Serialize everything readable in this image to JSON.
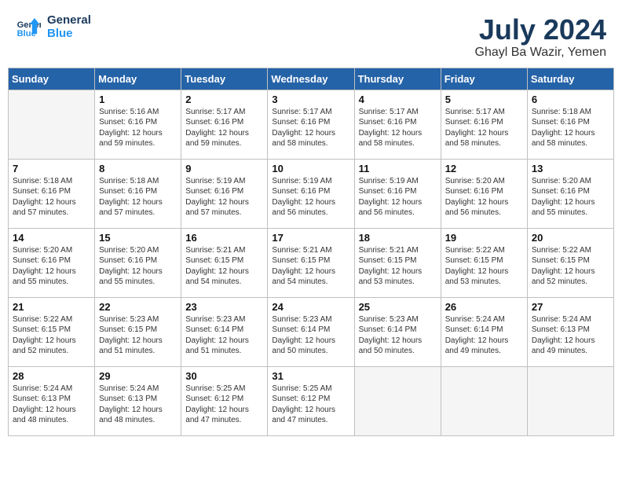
{
  "header": {
    "logo_line1": "General",
    "logo_line2": "Blue",
    "month_year": "July 2024",
    "location": "Ghayl Ba Wazir, Yemen"
  },
  "weekdays": [
    "Sunday",
    "Monday",
    "Tuesday",
    "Wednesday",
    "Thursday",
    "Friday",
    "Saturday"
  ],
  "weeks": [
    [
      {
        "day": "",
        "content": ""
      },
      {
        "day": "1",
        "content": "Sunrise: 5:16 AM\nSunset: 6:16 PM\nDaylight: 12 hours\nand 59 minutes."
      },
      {
        "day": "2",
        "content": "Sunrise: 5:17 AM\nSunset: 6:16 PM\nDaylight: 12 hours\nand 59 minutes."
      },
      {
        "day": "3",
        "content": "Sunrise: 5:17 AM\nSunset: 6:16 PM\nDaylight: 12 hours\nand 58 minutes."
      },
      {
        "day": "4",
        "content": "Sunrise: 5:17 AM\nSunset: 6:16 PM\nDaylight: 12 hours\nand 58 minutes."
      },
      {
        "day": "5",
        "content": "Sunrise: 5:17 AM\nSunset: 6:16 PM\nDaylight: 12 hours\nand 58 minutes."
      },
      {
        "day": "6",
        "content": "Sunrise: 5:18 AM\nSunset: 6:16 PM\nDaylight: 12 hours\nand 58 minutes."
      }
    ],
    [
      {
        "day": "7",
        "content": "Sunrise: 5:18 AM\nSunset: 6:16 PM\nDaylight: 12 hours\nand 57 minutes."
      },
      {
        "day": "8",
        "content": "Sunrise: 5:18 AM\nSunset: 6:16 PM\nDaylight: 12 hours\nand 57 minutes."
      },
      {
        "day": "9",
        "content": "Sunrise: 5:19 AM\nSunset: 6:16 PM\nDaylight: 12 hours\nand 57 minutes."
      },
      {
        "day": "10",
        "content": "Sunrise: 5:19 AM\nSunset: 6:16 PM\nDaylight: 12 hours\nand 56 minutes."
      },
      {
        "day": "11",
        "content": "Sunrise: 5:19 AM\nSunset: 6:16 PM\nDaylight: 12 hours\nand 56 minutes."
      },
      {
        "day": "12",
        "content": "Sunrise: 5:20 AM\nSunset: 6:16 PM\nDaylight: 12 hours\nand 56 minutes."
      },
      {
        "day": "13",
        "content": "Sunrise: 5:20 AM\nSunset: 6:16 PM\nDaylight: 12 hours\nand 55 minutes."
      }
    ],
    [
      {
        "day": "14",
        "content": "Sunrise: 5:20 AM\nSunset: 6:16 PM\nDaylight: 12 hours\nand 55 minutes."
      },
      {
        "day": "15",
        "content": "Sunrise: 5:20 AM\nSunset: 6:16 PM\nDaylight: 12 hours\nand 55 minutes."
      },
      {
        "day": "16",
        "content": "Sunrise: 5:21 AM\nSunset: 6:15 PM\nDaylight: 12 hours\nand 54 minutes."
      },
      {
        "day": "17",
        "content": "Sunrise: 5:21 AM\nSunset: 6:15 PM\nDaylight: 12 hours\nand 54 minutes."
      },
      {
        "day": "18",
        "content": "Sunrise: 5:21 AM\nSunset: 6:15 PM\nDaylight: 12 hours\nand 53 minutes."
      },
      {
        "day": "19",
        "content": "Sunrise: 5:22 AM\nSunset: 6:15 PM\nDaylight: 12 hours\nand 53 minutes."
      },
      {
        "day": "20",
        "content": "Sunrise: 5:22 AM\nSunset: 6:15 PM\nDaylight: 12 hours\nand 52 minutes."
      }
    ],
    [
      {
        "day": "21",
        "content": "Sunrise: 5:22 AM\nSunset: 6:15 PM\nDaylight: 12 hours\nand 52 minutes."
      },
      {
        "day": "22",
        "content": "Sunrise: 5:23 AM\nSunset: 6:15 PM\nDaylight: 12 hours\nand 51 minutes."
      },
      {
        "day": "23",
        "content": "Sunrise: 5:23 AM\nSunset: 6:14 PM\nDaylight: 12 hours\nand 51 minutes."
      },
      {
        "day": "24",
        "content": "Sunrise: 5:23 AM\nSunset: 6:14 PM\nDaylight: 12 hours\nand 50 minutes."
      },
      {
        "day": "25",
        "content": "Sunrise: 5:23 AM\nSunset: 6:14 PM\nDaylight: 12 hours\nand 50 minutes."
      },
      {
        "day": "26",
        "content": "Sunrise: 5:24 AM\nSunset: 6:14 PM\nDaylight: 12 hours\nand 49 minutes."
      },
      {
        "day": "27",
        "content": "Sunrise: 5:24 AM\nSunset: 6:13 PM\nDaylight: 12 hours\nand 49 minutes."
      }
    ],
    [
      {
        "day": "28",
        "content": "Sunrise: 5:24 AM\nSunset: 6:13 PM\nDaylight: 12 hours\nand 48 minutes."
      },
      {
        "day": "29",
        "content": "Sunrise: 5:24 AM\nSunset: 6:13 PM\nDaylight: 12 hours\nand 48 minutes."
      },
      {
        "day": "30",
        "content": "Sunrise: 5:25 AM\nSunset: 6:12 PM\nDaylight: 12 hours\nand 47 minutes."
      },
      {
        "day": "31",
        "content": "Sunrise: 5:25 AM\nSunset: 6:12 PM\nDaylight: 12 hours\nand 47 minutes."
      },
      {
        "day": "",
        "content": ""
      },
      {
        "day": "",
        "content": ""
      },
      {
        "day": "",
        "content": ""
      }
    ]
  ]
}
